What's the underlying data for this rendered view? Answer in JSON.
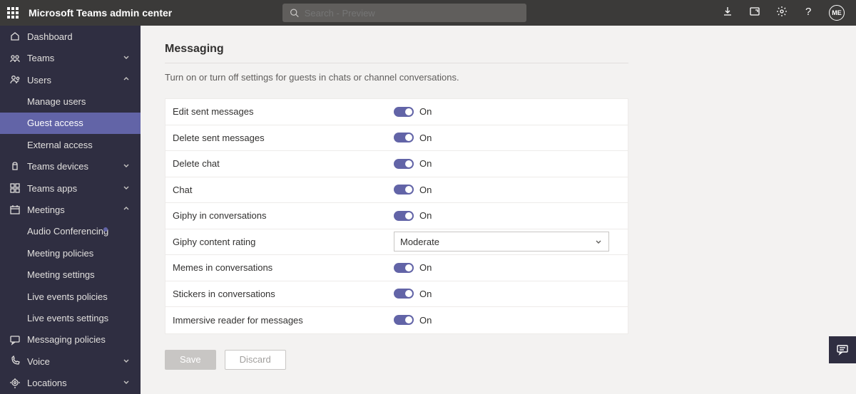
{
  "header": {
    "title": "Microsoft Teams admin center",
    "search_placeholder": "Search - Preview",
    "avatar": "ME"
  },
  "sidebar": {
    "items": [
      {
        "id": "dashboard",
        "label": "Dashboard",
        "icon": "home",
        "type": "top"
      },
      {
        "id": "teams",
        "label": "Teams",
        "icon": "teams",
        "type": "top",
        "chev": "down"
      },
      {
        "id": "users",
        "label": "Users",
        "icon": "users",
        "type": "top",
        "chev": "up"
      },
      {
        "id": "manage-users",
        "label": "Manage users",
        "type": "sub"
      },
      {
        "id": "guest-access",
        "label": "Guest access",
        "type": "sub",
        "selected": true
      },
      {
        "id": "external-access",
        "label": "External access",
        "type": "sub"
      },
      {
        "id": "teams-devices",
        "label": "Teams devices",
        "icon": "devices",
        "type": "top",
        "chev": "down"
      },
      {
        "id": "teams-apps",
        "label": "Teams apps",
        "icon": "apps",
        "type": "top",
        "chev": "down"
      },
      {
        "id": "meetings",
        "label": "Meetings",
        "icon": "meetings",
        "type": "top",
        "chev": "up"
      },
      {
        "id": "audio-conferencing",
        "label": "Audio Conferencing",
        "type": "sub",
        "dot": true
      },
      {
        "id": "meeting-policies",
        "label": "Meeting policies",
        "type": "sub"
      },
      {
        "id": "meeting-settings",
        "label": "Meeting settings",
        "type": "sub"
      },
      {
        "id": "live-events-policies",
        "label": "Live events policies",
        "type": "sub"
      },
      {
        "id": "live-events-settings",
        "label": "Live events settings",
        "type": "sub"
      },
      {
        "id": "messaging-policies",
        "label": "Messaging policies",
        "icon": "message",
        "type": "top"
      },
      {
        "id": "voice",
        "label": "Voice",
        "icon": "voice",
        "type": "top",
        "chev": "down"
      },
      {
        "id": "locations",
        "label": "Locations",
        "icon": "location",
        "type": "top",
        "chev": "down"
      }
    ]
  },
  "main": {
    "title": "Messaging",
    "desc": "Turn on or turn off settings for guests in chats or channel conversations.",
    "settings": [
      {
        "label": "Edit sent messages",
        "type": "toggle",
        "value": "On"
      },
      {
        "label": "Delete sent messages",
        "type": "toggle",
        "value": "On"
      },
      {
        "label": "Delete chat",
        "type": "toggle",
        "value": "On"
      },
      {
        "label": "Chat",
        "type": "toggle",
        "value": "On"
      },
      {
        "label": "Giphy in conversations",
        "type": "toggle",
        "value": "On"
      },
      {
        "label": "Giphy content rating",
        "type": "dropdown",
        "value": "Moderate"
      },
      {
        "label": "Memes in conversations",
        "type": "toggle",
        "value": "On"
      },
      {
        "label": "Stickers in conversations",
        "type": "toggle",
        "value": "On"
      },
      {
        "label": "Immersive reader for messages",
        "type": "toggle",
        "value": "On"
      }
    ],
    "save": "Save",
    "discard": "Discard"
  }
}
